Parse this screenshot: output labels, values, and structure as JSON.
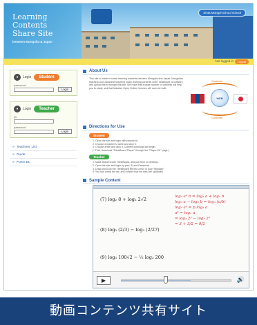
{
  "header": {
    "brand_title_line1": "Learning Contents",
    "brand_title_line2": "Share Site",
    "brand_subtitle": "between Mongolia & Japan",
    "photo_badge": "Sinta Mongol school school"
  },
  "status_bar": {
    "login_status": "Not logged in",
    "logout_label": "Logout"
  },
  "sidebar": {
    "student_login": {
      "login_word": "Login",
      "role": "Student",
      "field_label": "password",
      "button": "Login"
    },
    "teacher_login": {
      "login_word": "Login",
      "role": "Teacher",
      "id_label": "ID",
      "password_label": "password",
      "button": "Login"
    },
    "links": [
      {
        "label": "Teachers' List"
      },
      {
        "label": "Guide"
      },
      {
        "label": "Poem DL"
      }
    ]
  },
  "about": {
    "title": "About Us",
    "text": "This site is made to share learning contents between Mongolia and Japan. Mongolian teachers and Japanese teachers make learning contents with ThinkBoard, a software, and upload them through this site. We hope that a large number of contents will help you to study, and that Massive Open Online Courses will soon be built.",
    "diagram": {
      "top_label": "Contents",
      "center_label": "WEB",
      "bottom_label": "Contents"
    }
  },
  "directions": {
    "title": "Directions for Use",
    "student_tag": "Student",
    "student_steps": [
      "1. Open the site and login with password.",
      "2. Choose a teacher's name and click it.",
      "3. Choose a title and click it. Content download will begin.",
      "(* First, download \"ThinkBoard Player\" through the \"Player DL\" page.)"
    ],
    "teacher_tag": "Teacher",
    "teacher_steps": [
      "1. Make lectures with ThinkBoard, and put them on desktop.",
      "2. Open the site and login by your ID and Password.",
      "3. Drag and Drop the ThinkBoard file into a box in your \"Mypage\".",
      "4. You can check the list, and confirm that the files are uploaded."
    ]
  },
  "sample": {
    "title": "Sample Content",
    "equations": [
      "(7)  log₂ 8 + log₂ 2√2",
      "(8)  log₃ (2/3) − log₃ (2/27)",
      "(9)  log₃ 100√2 − ½ log₃ 200"
    ],
    "handwriting": [
      "log₃ a² b = log₃ a + log₃ b",
      "log₃ a − log₃ b = log₃ (a/b)",
      "log₃ aᵖ = p log₃ a",
      "a³ = log₃ a",
      "= log₃ 2ᵖ − log₃ 2³",
      "= 3 + 3/2 = 9/2"
    ],
    "player": {
      "progress": 0.63
    }
  },
  "caption": "動画コンテンツ共有サイト",
  "colors": {
    "brand_blue": "#3d9bd6",
    "accent_yellow": "#f6e25a",
    "student_orange": "#ef7d2f",
    "teacher_green": "#3fa84a",
    "section_blue": "#3173c4",
    "caption_navy": "#1a427a",
    "ink_red": "#d1303d"
  },
  "icons": {
    "login": "user-icon",
    "link_arrow": "arrow-right-icon",
    "play": "play-icon",
    "volume": "speaker-icon"
  }
}
